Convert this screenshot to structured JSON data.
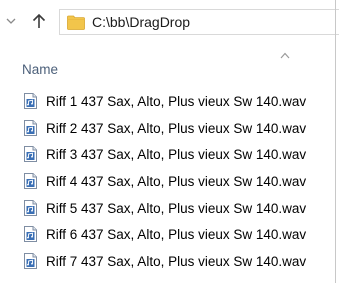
{
  "address_bar": {
    "path": "C:\\bb\\DragDrop",
    "folder_icon": "folder-icon",
    "folder_color": "#f2c54b"
  },
  "nav": {
    "dropdown_icon": "chevron-down-icon",
    "up_icon": "arrow-up-icon"
  },
  "columns": {
    "name_label": "Name",
    "sort_icon": "chevron-up-icon"
  },
  "files": [
    {
      "name": "Riff 1 437 Sax, Alto, Plus vieux Sw 140.wav",
      "icon": "audio-file-icon"
    },
    {
      "name": "Riff 2 437 Sax, Alto, Plus vieux Sw 140.wav",
      "icon": "audio-file-icon"
    },
    {
      "name": "Riff 3 437 Sax, Alto, Plus vieux Sw 140.wav",
      "icon": "audio-file-icon"
    },
    {
      "name": "Riff 4 437 Sax, Alto, Plus vieux Sw 140.wav",
      "icon": "audio-file-icon"
    },
    {
      "name": "Riff 5 437 Sax, Alto, Plus vieux Sw 140.wav",
      "icon": "audio-file-icon"
    },
    {
      "name": "Riff 6 437 Sax, Alto, Plus vieux Sw 140.wav",
      "icon": "audio-file-icon"
    },
    {
      "name": "Riff 7 437 Sax, Alto, Plus vieux Sw 140.wav",
      "icon": "audio-file-icon"
    }
  ],
  "colors": {
    "header_text": "#4c607a",
    "file_icon_blue": "#3a6fb5"
  }
}
